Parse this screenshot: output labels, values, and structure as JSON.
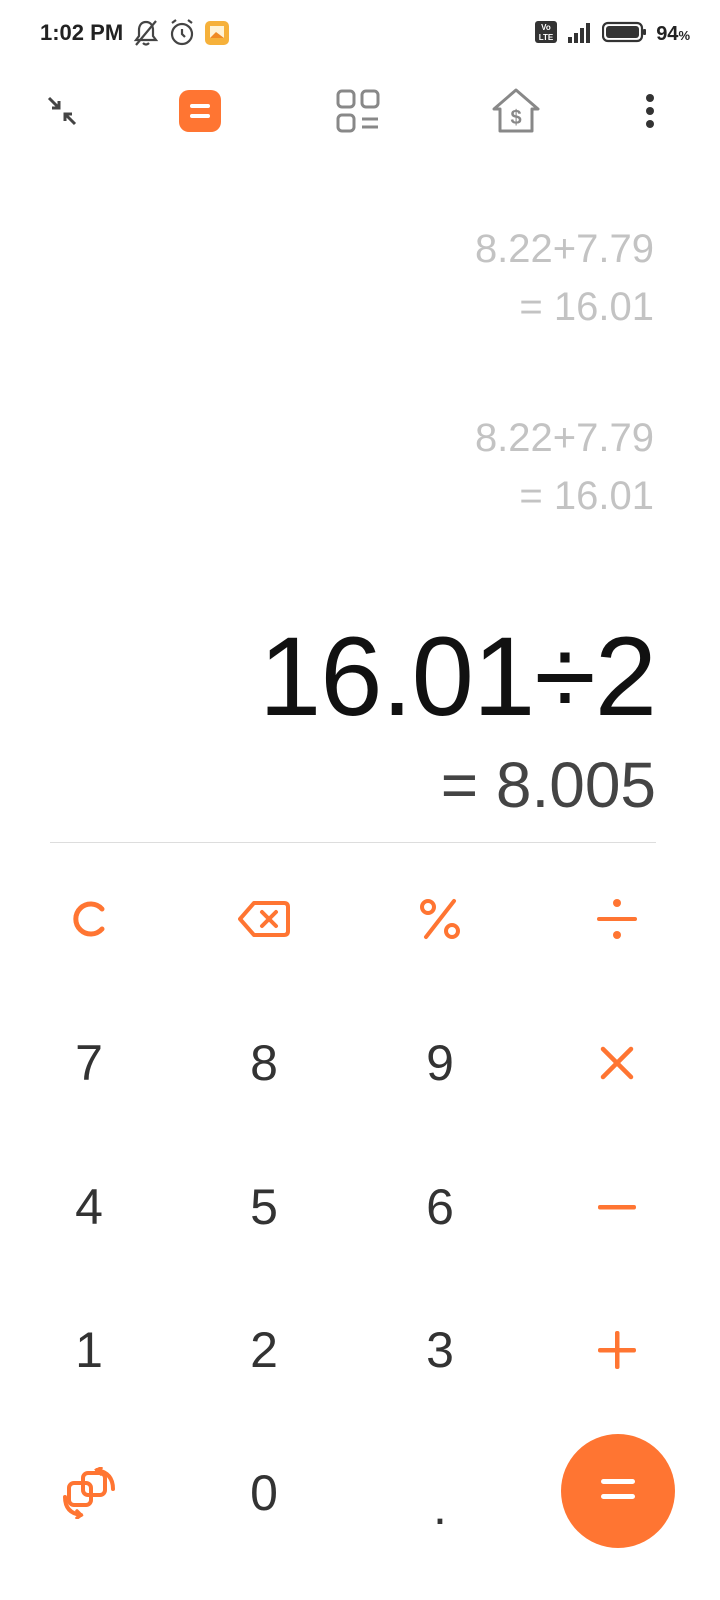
{
  "status_bar": {
    "time": "1:02 PM",
    "battery_percent": "94",
    "battery_unit": "%",
    "volte_badge": [
      "Vo",
      "LTE"
    ],
    "icons_left": [
      "bell-off-icon",
      "alarm-clock-icon",
      "gallery-app-icon"
    ],
    "icons_right": [
      "volte-icon",
      "signal-icon",
      "battery-icon"
    ]
  },
  "toolbar": {
    "items": [
      {
        "name": "collapse-icon",
        "active": false
      },
      {
        "name": "calculator-tab-icon",
        "active": true
      },
      {
        "name": "converter-tab-icon",
        "active": false
      },
      {
        "name": "mortgage-tab-icon",
        "active": false
      },
      {
        "name": "more-options-icon",
        "active": false
      }
    ],
    "accent_color": "#ff7532",
    "mortgage_symbol": "$"
  },
  "history": [
    {
      "expression": "8.22+7.79",
      "result": "= 16.01"
    },
    {
      "expression": "8.22+7.79",
      "result": "= 16.01"
    }
  ],
  "display": {
    "expression": "16.01÷2",
    "result": "= 8.005"
  },
  "keypad": {
    "row1": [
      "C",
      "backspace",
      "%",
      "÷"
    ],
    "row2": [
      "7",
      "8",
      "9",
      "×"
    ],
    "row3": [
      "4",
      "5",
      "6",
      "−"
    ],
    "row4": [
      "1",
      "2",
      "3",
      "+"
    ],
    "row5": [
      "swap",
      "0",
      ".",
      "="
    ],
    "operator_color": "#ff7532",
    "number_color": "#333333"
  }
}
